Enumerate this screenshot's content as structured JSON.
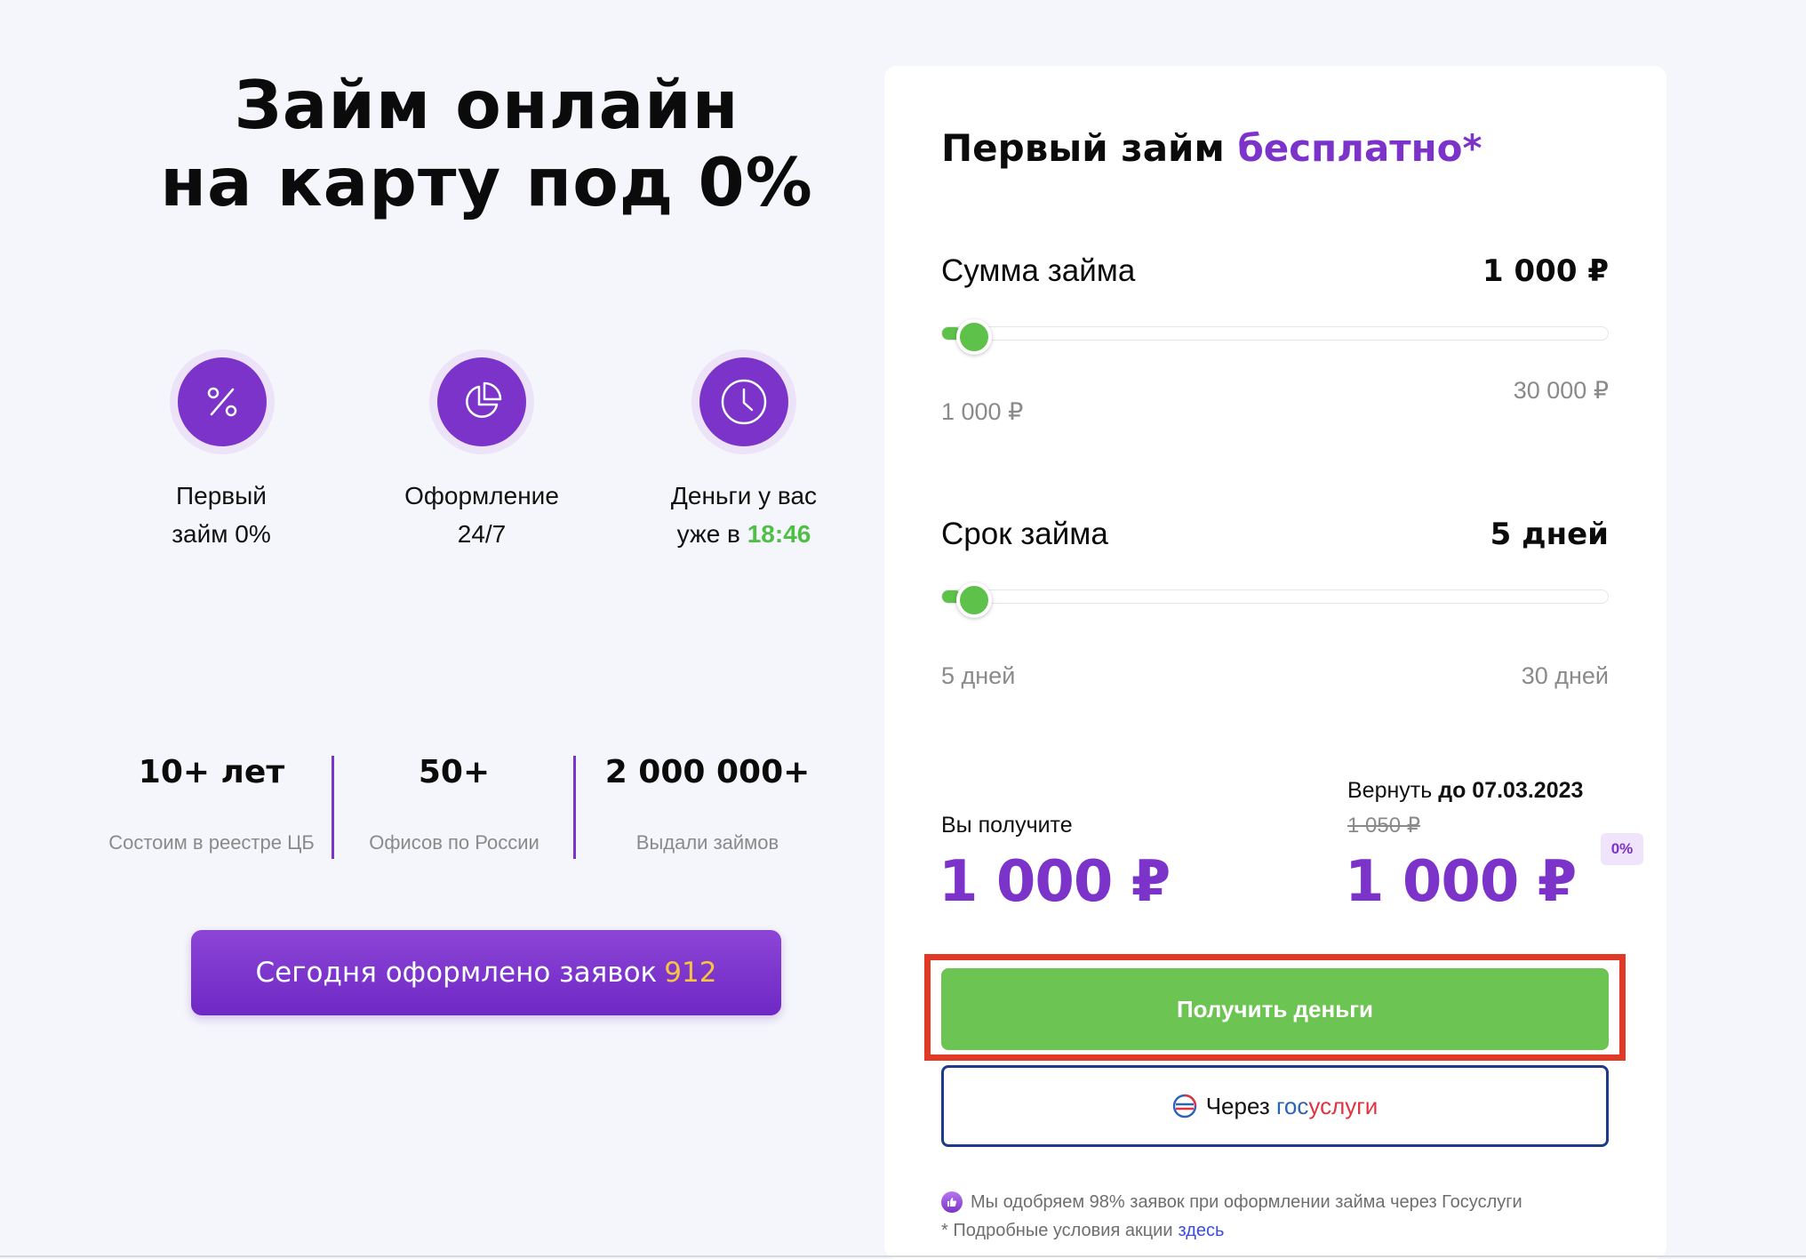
{
  "hero": {
    "title_line1": "Займ онлайн",
    "title_line2": "на карту под 0%"
  },
  "features": [
    {
      "icon": "percent-icon",
      "line1": "Первый",
      "line2": "займ 0%"
    },
    {
      "icon": "pie-chart-icon",
      "line1": "Оформление",
      "line2": "24/7"
    },
    {
      "icon": "clock-icon",
      "line1": "Деньги у вас",
      "line2_prefix": "уже в",
      "time": "18:46"
    }
  ],
  "stats": [
    {
      "value": "10+ лет",
      "label": "Состоим в реестре ЦБ"
    },
    {
      "value": "50+",
      "label": "Офисов по России"
    },
    {
      "value": "2 000 000+",
      "label": "Выдали займов"
    }
  ],
  "apps_banner": {
    "text": "Сегодня оформлено заявок",
    "count": "912"
  },
  "card": {
    "title_main": "Первый займ",
    "title_accent": "бесплатно*",
    "amount": {
      "label": "Сумма займа",
      "value": "1 000 ₽",
      "min_label": "1 000 ₽",
      "max_label": "30 000 ₽",
      "level": 0.03
    },
    "term": {
      "label": "Срок займа",
      "value": "5 дней",
      "min_label": "5 дней",
      "max_label": "30 дней",
      "level": 0.03
    },
    "summary": {
      "receive_label": "Вы получите",
      "receive_value": "1 000 ₽",
      "return_label": "Вернуть",
      "return_date": "до 07.03.2023",
      "old_value": "1 050 ₽",
      "return_value": "1 000 ₽",
      "badge": "0%"
    },
    "get_money_button": "Получить деньги",
    "gosuslugi_button": {
      "prefix": "Через",
      "brand_part1": "гос",
      "brand_part2": "услуги"
    },
    "notes": {
      "approval": "Мы одобряем 98% заявок при оформлении займа через Госуслуги",
      "conditions": "* Подробные условия акции",
      "conditions_link": "здесь"
    }
  },
  "colors": {
    "accent_purple": "#7b33c9",
    "green": "#6cc452",
    "highlight_red": "#e03a26",
    "gold": "#f6c343"
  }
}
